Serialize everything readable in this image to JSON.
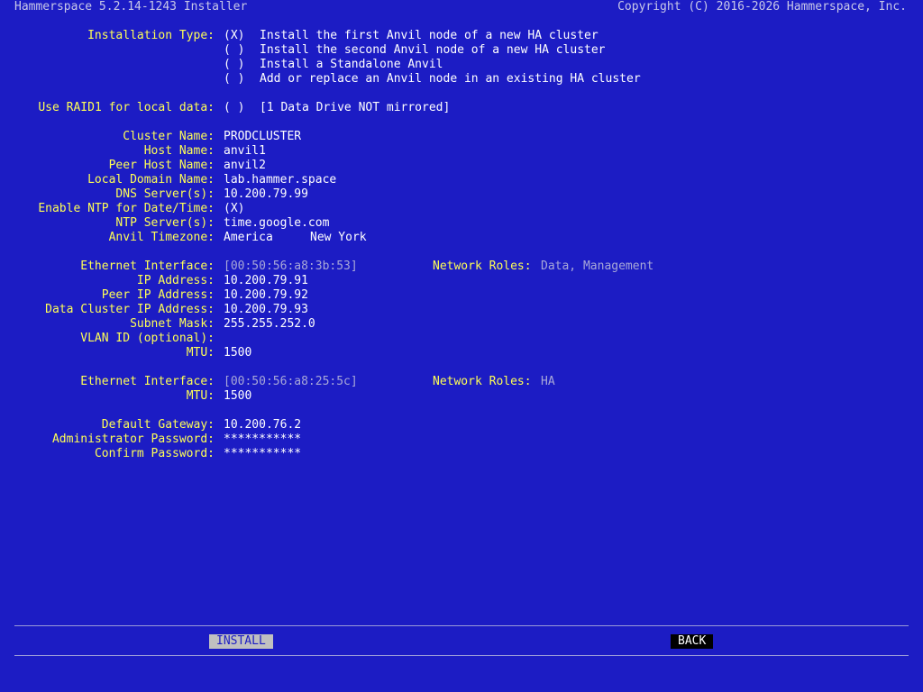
{
  "title": "Hammerspace 5.2.14-1243 Installer",
  "copyright": "Copyright (C) 2016-2026 Hammerspace, Inc.",
  "install_type": {
    "label": "Installation Type:",
    "options": [
      {
        "mark": "(X)",
        "text": "Install the first Anvil node of a new HA cluster"
      },
      {
        "mark": "( )",
        "text": "Install the second Anvil node of a new HA cluster"
      },
      {
        "mark": "( )",
        "text": "Install a Standalone Anvil"
      },
      {
        "mark": "( )",
        "text": "Add or replace an Anvil node in an existing HA cluster"
      }
    ]
  },
  "raid": {
    "label": "Use RAID1 for local data:",
    "mark": "( )",
    "note": "[1 Data Drive NOT mirrored]"
  },
  "cluster": {
    "cluster_name_label": "Cluster Name:",
    "cluster_name": "PRODCLUSTER",
    "host_name_label": "Host Name:",
    "host_name": "anvil1",
    "peer_host_label": "Peer Host Name:",
    "peer_host": "anvil2",
    "domain_label": "Local Domain Name:",
    "domain": "lab.hammer.space",
    "dns_label": "DNS Server(s):",
    "dns": "10.200.79.99",
    "ntp_enable_label": "Enable NTP for Date/Time:",
    "ntp_enable": "(X)",
    "ntp_label": "NTP Server(s):",
    "ntp": "time.google.com",
    "tz_label": "Anvil Timezone:",
    "tz_region": "America",
    "tz_city": "New York"
  },
  "eth1": {
    "iface_label": "Ethernet Interface:",
    "iface": "[00:50:56:a8:3b:53]",
    "roles_label": "Network Roles:",
    "roles": "Data, Management",
    "ip_label": "IP Address:",
    "ip": "10.200.79.91",
    "peer_ip_label": "Peer IP Address:",
    "peer_ip": "10.200.79.92",
    "dc_ip_label": "Data Cluster IP Address:",
    "dc_ip": "10.200.79.93",
    "mask_label": "Subnet Mask:",
    "mask": "255.255.252.0",
    "vlan_label": "VLAN ID (optional):",
    "vlan": "",
    "mtu_label": "MTU:",
    "mtu": "1500"
  },
  "eth2": {
    "iface_label": "Ethernet Interface:",
    "iface": "[00:50:56:a8:25:5c]",
    "roles_label": "Network Roles:",
    "roles": "HA",
    "mtu_label": "MTU:",
    "mtu": "1500"
  },
  "auth": {
    "gateway_label": "Default Gateway:",
    "gateway": "10.200.76.2",
    "admin_pw_label": "Administrator Password:",
    "admin_pw": "***********",
    "confirm_pw_label": "Confirm Password:",
    "confirm_pw": "***********"
  },
  "buttons": {
    "install": "INSTALL",
    "back": "BACK"
  }
}
